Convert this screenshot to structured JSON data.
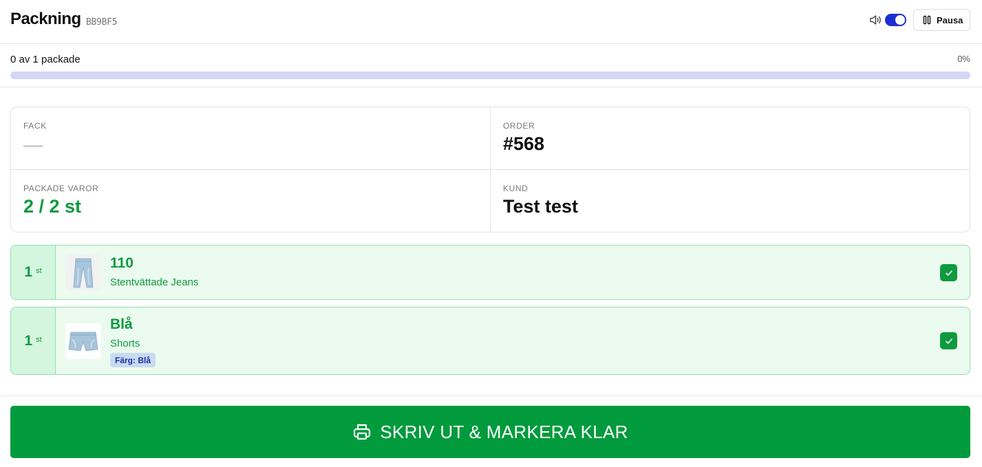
{
  "header": {
    "title": "Packning",
    "code": "BB9BF5",
    "sound_on": true,
    "pause_label": "Pausa"
  },
  "progress": {
    "text": "0 av 1 packade",
    "percent_label": "0%",
    "percent": 0
  },
  "info": {
    "fack_label": "FACK",
    "fack_value": "",
    "order_label": "ORDER",
    "order_value": "#568",
    "packed_label": "PACKADE VAROR",
    "packed_value": "2 / 2 st",
    "customer_label": "KUND",
    "customer_value": "Test test"
  },
  "items": [
    {
      "qty": "1",
      "unit": "st",
      "title": "110",
      "subtitle": "Stentvättade Jeans",
      "tag": "",
      "checked": true,
      "image": "jeans"
    },
    {
      "qty": "1",
      "unit": "st",
      "title": "Blå",
      "subtitle": "Shorts",
      "tag": "Färg: Blå",
      "checked": true,
      "image": "shorts"
    }
  ],
  "footer": {
    "print_label": "SKRIV UT & MARKERA KLAR"
  },
  "colors": {
    "accent_blue": "#1b2fd1",
    "success_green": "#0f9a3e",
    "button_green": "#019b3d",
    "item_bg": "#ebfbef"
  },
  "icons": {
    "sound": "speaker-icon",
    "pause": "pause-icon",
    "check": "check-icon",
    "print": "printer-icon"
  }
}
